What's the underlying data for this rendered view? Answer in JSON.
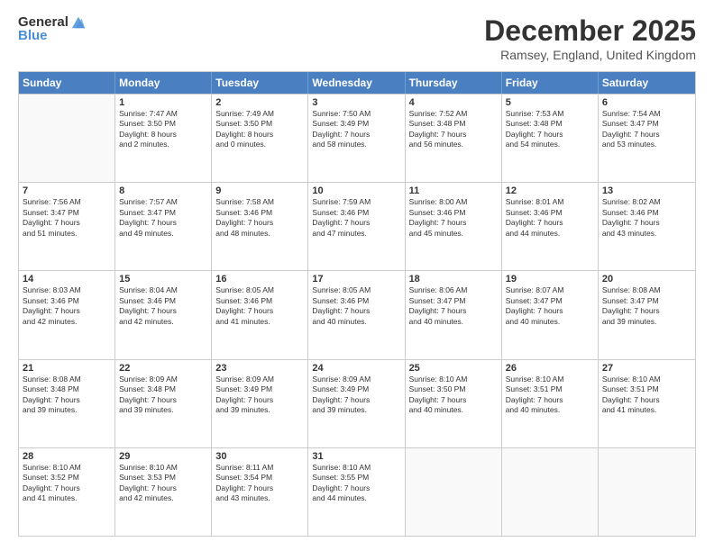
{
  "header": {
    "logo_general": "General",
    "logo_blue": "Blue",
    "title": "December 2025",
    "location": "Ramsey, England, United Kingdom"
  },
  "days_of_week": [
    "Sunday",
    "Monday",
    "Tuesday",
    "Wednesday",
    "Thursday",
    "Friday",
    "Saturday"
  ],
  "weeks": [
    [
      {
        "day": "",
        "info": ""
      },
      {
        "day": "1",
        "info": "Sunrise: 7:47 AM\nSunset: 3:50 PM\nDaylight: 8 hours\nand 2 minutes."
      },
      {
        "day": "2",
        "info": "Sunrise: 7:49 AM\nSunset: 3:50 PM\nDaylight: 8 hours\nand 0 minutes."
      },
      {
        "day": "3",
        "info": "Sunrise: 7:50 AM\nSunset: 3:49 PM\nDaylight: 7 hours\nand 58 minutes."
      },
      {
        "day": "4",
        "info": "Sunrise: 7:52 AM\nSunset: 3:48 PM\nDaylight: 7 hours\nand 56 minutes."
      },
      {
        "day": "5",
        "info": "Sunrise: 7:53 AM\nSunset: 3:48 PM\nDaylight: 7 hours\nand 54 minutes."
      },
      {
        "day": "6",
        "info": "Sunrise: 7:54 AM\nSunset: 3:47 PM\nDaylight: 7 hours\nand 53 minutes."
      }
    ],
    [
      {
        "day": "7",
        "info": "Sunrise: 7:56 AM\nSunset: 3:47 PM\nDaylight: 7 hours\nand 51 minutes."
      },
      {
        "day": "8",
        "info": "Sunrise: 7:57 AM\nSunset: 3:47 PM\nDaylight: 7 hours\nand 49 minutes."
      },
      {
        "day": "9",
        "info": "Sunrise: 7:58 AM\nSunset: 3:46 PM\nDaylight: 7 hours\nand 48 minutes."
      },
      {
        "day": "10",
        "info": "Sunrise: 7:59 AM\nSunset: 3:46 PM\nDaylight: 7 hours\nand 47 minutes."
      },
      {
        "day": "11",
        "info": "Sunrise: 8:00 AM\nSunset: 3:46 PM\nDaylight: 7 hours\nand 45 minutes."
      },
      {
        "day": "12",
        "info": "Sunrise: 8:01 AM\nSunset: 3:46 PM\nDaylight: 7 hours\nand 44 minutes."
      },
      {
        "day": "13",
        "info": "Sunrise: 8:02 AM\nSunset: 3:46 PM\nDaylight: 7 hours\nand 43 minutes."
      }
    ],
    [
      {
        "day": "14",
        "info": "Sunrise: 8:03 AM\nSunset: 3:46 PM\nDaylight: 7 hours\nand 42 minutes."
      },
      {
        "day": "15",
        "info": "Sunrise: 8:04 AM\nSunset: 3:46 PM\nDaylight: 7 hours\nand 42 minutes."
      },
      {
        "day": "16",
        "info": "Sunrise: 8:05 AM\nSunset: 3:46 PM\nDaylight: 7 hours\nand 41 minutes."
      },
      {
        "day": "17",
        "info": "Sunrise: 8:05 AM\nSunset: 3:46 PM\nDaylight: 7 hours\nand 40 minutes."
      },
      {
        "day": "18",
        "info": "Sunrise: 8:06 AM\nSunset: 3:47 PM\nDaylight: 7 hours\nand 40 minutes."
      },
      {
        "day": "19",
        "info": "Sunrise: 8:07 AM\nSunset: 3:47 PM\nDaylight: 7 hours\nand 40 minutes."
      },
      {
        "day": "20",
        "info": "Sunrise: 8:08 AM\nSunset: 3:47 PM\nDaylight: 7 hours\nand 39 minutes."
      }
    ],
    [
      {
        "day": "21",
        "info": "Sunrise: 8:08 AM\nSunset: 3:48 PM\nDaylight: 7 hours\nand 39 minutes."
      },
      {
        "day": "22",
        "info": "Sunrise: 8:09 AM\nSunset: 3:48 PM\nDaylight: 7 hours\nand 39 minutes."
      },
      {
        "day": "23",
        "info": "Sunrise: 8:09 AM\nSunset: 3:49 PM\nDaylight: 7 hours\nand 39 minutes."
      },
      {
        "day": "24",
        "info": "Sunrise: 8:09 AM\nSunset: 3:49 PM\nDaylight: 7 hours\nand 39 minutes."
      },
      {
        "day": "25",
        "info": "Sunrise: 8:10 AM\nSunset: 3:50 PM\nDaylight: 7 hours\nand 40 minutes."
      },
      {
        "day": "26",
        "info": "Sunrise: 8:10 AM\nSunset: 3:51 PM\nDaylight: 7 hours\nand 40 minutes."
      },
      {
        "day": "27",
        "info": "Sunrise: 8:10 AM\nSunset: 3:51 PM\nDaylight: 7 hours\nand 41 minutes."
      }
    ],
    [
      {
        "day": "28",
        "info": "Sunrise: 8:10 AM\nSunset: 3:52 PM\nDaylight: 7 hours\nand 41 minutes."
      },
      {
        "day": "29",
        "info": "Sunrise: 8:10 AM\nSunset: 3:53 PM\nDaylight: 7 hours\nand 42 minutes."
      },
      {
        "day": "30",
        "info": "Sunrise: 8:11 AM\nSunset: 3:54 PM\nDaylight: 7 hours\nand 43 minutes."
      },
      {
        "day": "31",
        "info": "Sunrise: 8:10 AM\nSunset: 3:55 PM\nDaylight: 7 hours\nand 44 minutes."
      },
      {
        "day": "",
        "info": ""
      },
      {
        "day": "",
        "info": ""
      },
      {
        "day": "",
        "info": ""
      }
    ]
  ]
}
